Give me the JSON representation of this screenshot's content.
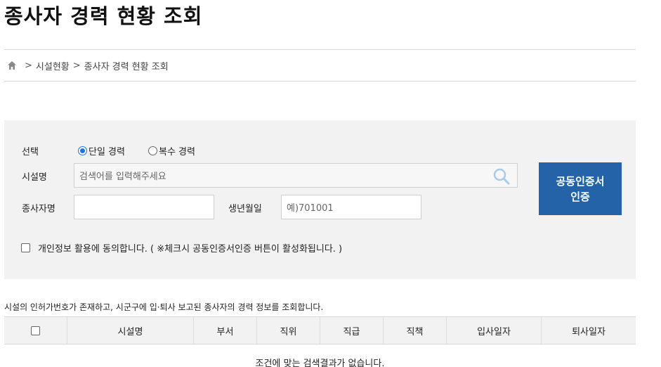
{
  "page": {
    "title": "종사자 경력 현황 조회"
  },
  "breadcrumb": {
    "items": [
      "시설현황",
      "종사자 경력 현황 조회"
    ]
  },
  "search": {
    "select_label": "선택",
    "radio_single": "단일 경력",
    "radio_multiple": "복수 경력",
    "radio_selected": "단일 경력",
    "facility_label": "시설명",
    "facility_placeholder": "검색어를 입력해주세요",
    "worker_label": "종사자명",
    "worker_value": "",
    "birth_label": "생년월일",
    "birth_placeholder": "예)701001",
    "cert_button_line1": "공동인증서",
    "cert_button_line2": "인증",
    "agree_text": "개인정보 활용에 동의합니다. ( ※체크시 공동인증서인증 버튼이 활성화됩니다. )",
    "agree_checked": false
  },
  "notice": "시설의 인허가번호가 존재하고, 시군구에 입·퇴사 보고된 종사자의 경력 정보를 조회합니다.",
  "table": {
    "columns": [
      "시설명",
      "부서",
      "직위",
      "직급",
      "직책",
      "입사일자",
      "퇴사일자"
    ],
    "empty_message": "조건에 맞는 검색결과가 없습니다."
  },
  "colors": {
    "accent": "#2563a8",
    "panel": "#f2f2f2",
    "radio": "#1a73e8"
  },
  "icons": {
    "home": "home-icon",
    "search": "search-icon"
  }
}
